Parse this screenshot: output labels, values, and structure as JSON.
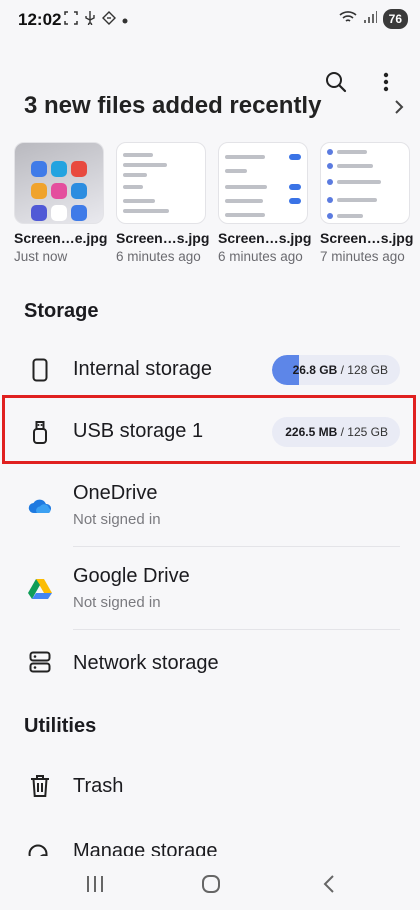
{
  "status_bar": {
    "time": "12:02",
    "battery": "76",
    "left_icons": [
      "screenshot-icon",
      "usb-icon",
      "data-icon",
      "dot-icon"
    ],
    "right_icons": [
      "wifi-icon",
      "signal-icon"
    ]
  },
  "toolbar": {
    "search_icon": "search-icon",
    "more_icon": "more-vert-icon"
  },
  "recent": {
    "title": "3 new files added recently",
    "files": [
      {
        "name": "Screen…e.jpg",
        "time": "Just now"
      },
      {
        "name": "Screen…s.jpg",
        "time": "6 minutes ago"
      },
      {
        "name": "Screen…s.jpg",
        "time": "6 minutes ago"
      },
      {
        "name": "Screen…s.jpg",
        "time": "7 minutes ago"
      }
    ]
  },
  "storage": {
    "section_title": "Storage",
    "items": [
      {
        "label": "Internal storage",
        "used": "26.8 GB",
        "total": "/ 128 GB",
        "used_fraction": 0.209,
        "icon": "phone-icon"
      },
      {
        "label": "USB storage 1",
        "used": "226.5 MB",
        "total": "/ 125 GB",
        "used_fraction": 0.002,
        "icon": "usb-drive-icon"
      },
      {
        "label": "OneDrive",
        "sub": "Not signed in",
        "icon": "onedrive-icon"
      },
      {
        "label": "Google Drive",
        "sub": "Not signed in",
        "icon": "google-drive-icon"
      },
      {
        "label": "Network storage",
        "icon": "network-storage-icon"
      }
    ]
  },
  "utilities": {
    "section_title": "Utilities",
    "items": [
      {
        "label": "Trash",
        "icon": "trash-icon"
      },
      {
        "label": "Manage storage",
        "icon": "manage-storage-icon"
      }
    ]
  },
  "colors": {
    "accent": "#5d86e8",
    "highlight": "#e02020",
    "background": "#f7f7f9"
  },
  "nav": {
    "recents_icon": "recents-icon",
    "home_icon": "home-icon",
    "back_icon": "back-icon"
  }
}
